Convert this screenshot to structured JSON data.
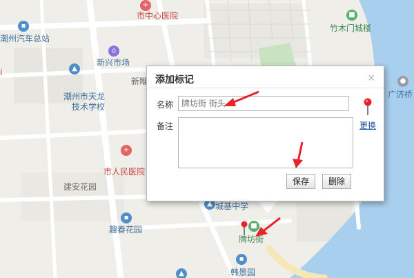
{
  "map": {
    "labels": {
      "hospital_center": "市中心医院",
      "bus_station": "潮州汽车总站",
      "zhumu_gate": "竹木门城楼",
      "xinxing_market": "新兴市场",
      "xinxing_partial": "新睢",
      "tianlong_school_line1": "潮州市天龙",
      "tianlong_school_line2": "技术学校",
      "guangji_bridge": "广济桥",
      "peoples_hospital": "市人民医院",
      "jianan_garden": "建安花园",
      "chengji_school": "城基中学",
      "quchun_garden": "趣春花园",
      "paifang_street": "牌坊街",
      "hanjing_garden": "韩景园",
      "left_edge_mark": "i"
    },
    "colors": {
      "water": "#a9cfee",
      "land": "#efeee9",
      "road": "#ffffff",
      "park": "#c8e3c0"
    }
  },
  "dialog": {
    "title": "添加标记",
    "close_symbol": "×",
    "name_label": "名称",
    "name_value": "牌坊街 街头",
    "note_label": "备注",
    "note_value": "",
    "change_link": "更换",
    "save_button": "保存",
    "delete_button": "删除"
  },
  "annotation_color": "#e8232a"
}
